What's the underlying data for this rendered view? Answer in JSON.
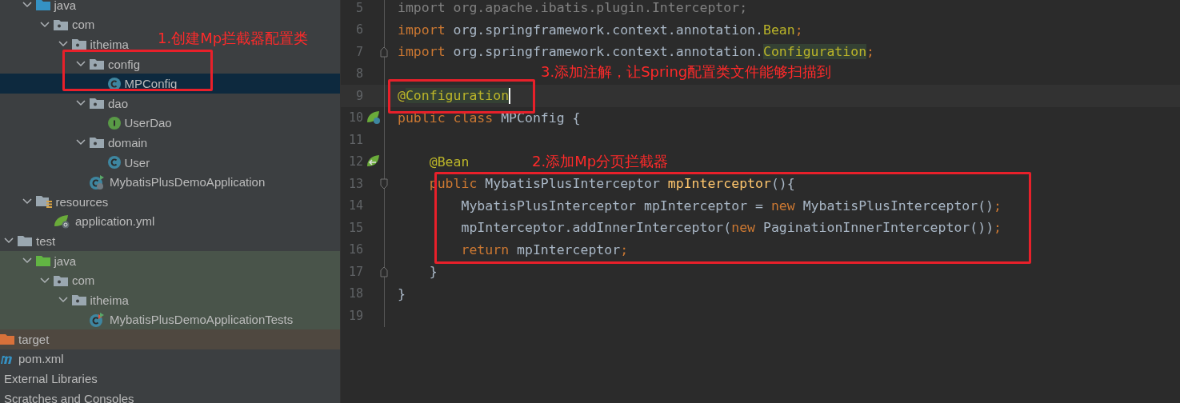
{
  "project_tree": [
    {
      "kind": "offscreen",
      "children": [
        {
          "label": "java",
          "kind": "source-folder",
          "expanded": true,
          "selected": false,
          "children": [
            {
              "label": "com",
              "kind": "package",
              "expanded": true,
              "selected": false,
              "children": [
                {
                  "label": "itheima",
                  "kind": "package",
                  "expanded": true,
                  "selected": false,
                  "children": [
                    {
                      "label": "config",
                      "kind": "package",
                      "expanded": true,
                      "selected": false,
                      "children": [
                        {
                          "label": "MPConfig",
                          "kind": "class",
                          "selected": true
                        }
                      ]
                    },
                    {
                      "label": "dao",
                      "kind": "package",
                      "expanded": true,
                      "selected": false,
                      "children": [
                        {
                          "label": "UserDao",
                          "kind": "interface",
                          "selected": false
                        }
                      ]
                    },
                    {
                      "label": "domain",
                      "kind": "package",
                      "expanded": true,
                      "selected": false,
                      "children": [
                        {
                          "label": "User",
                          "kind": "class",
                          "selected": false
                        }
                      ]
                    },
                    {
                      "label": "MybatisPlusDemoApplication",
                      "kind": "spring-app",
                      "selected": false
                    }
                  ]
                }
              ]
            }
          ]
        },
        {
          "label": "resources",
          "kind": "resources-folder",
          "expanded": true,
          "selected": false,
          "children": [
            {
              "label": "application.yml",
              "kind": "spring-yml",
              "selected": false
            }
          ]
        }
      ]
    },
    {
      "label": "test",
      "kind": "folder",
      "expanded": true,
      "selected": false,
      "children": [
        {
          "label": "java",
          "kind": "test-folder",
          "expanded": true,
          "selected": false,
          "color": "#49544a",
          "children": [
            {
              "label": "com",
              "kind": "package",
              "expanded": true,
              "selected": false,
              "color": "#49544a",
              "children": [
                {
                  "label": "itheima",
                  "kind": "package",
                  "expanded": true,
                  "selected": false,
                  "color": "#49544a",
                  "children": [
                    {
                      "label": "MybatisPlusDemoApplicationTests",
                      "kind": "test-class",
                      "selected": false,
                      "color": "#49544a"
                    }
                  ]
                }
              ]
            }
          ]
        }
      ]
    },
    {
      "label": "target",
      "kind": "excluded-folder",
      "selected": false,
      "color": "#4f4840"
    },
    {
      "label": "pom.xml",
      "kind": "maven",
      "selected": false
    },
    {
      "label": "External Libraries",
      "kind": "plain",
      "selected": false
    },
    {
      "label": "Scratches and Consoles",
      "kind": "plain",
      "selected": false
    }
  ],
  "editor": {
    "lines": [
      {
        "number": "5",
        "current": false,
        "tokens": [
          {
            "text": "import org.apache.ibatis.plugin.Interceptor;",
            "kind": "unused"
          }
        ]
      },
      {
        "number": "6",
        "current": false,
        "tokens": [
          {
            "text": "import ",
            "kind": "keyword"
          },
          {
            "text": "org.springframework.context.annotation.",
            "kind": "plain"
          },
          {
            "text": "Bean",
            "kind": "annotation"
          },
          {
            "text": ";",
            "kind": "keyword"
          }
        ]
      },
      {
        "number": "7",
        "current": false,
        "gutter": {
          "kind": "fold-end"
        },
        "tokens": [
          {
            "text": "import ",
            "kind": "keyword"
          },
          {
            "text": "org.springframework.context.annotation.",
            "kind": "plain"
          },
          {
            "text": "Configuration",
            "kind": "annotation-hl"
          },
          {
            "text": ";",
            "kind": "keyword"
          }
        ]
      },
      {
        "number": "8",
        "current": false
      },
      {
        "number": "9",
        "current": true,
        "tokens": [
          {
            "text": "@",
            "kind": "annotation"
          },
          {
            "text": "Configuration",
            "kind": "annotation-hl"
          }
        ]
      },
      {
        "number": "10",
        "current": false,
        "gutter": {
          "kind": "bean"
        },
        "tokens": [
          {
            "text": "public class ",
            "kind": "keyword"
          },
          {
            "text": "MPConfig {",
            "kind": "plain"
          }
        ]
      },
      {
        "number": "11",
        "current": false
      },
      {
        "number": "12",
        "current": false,
        "gutter": {
          "kind": "bean-link"
        },
        "tokens": [
          {
            "text": "    @Bean",
            "kind": "annotation"
          }
        ]
      },
      {
        "number": "13",
        "current": false,
        "gutter": {
          "kind": "fold-start"
        },
        "tokens": [
          {
            "text": "    public ",
            "kind": "keyword"
          },
          {
            "text": "MybatisPlusInterceptor ",
            "kind": "plain"
          },
          {
            "text": "mpInterceptor",
            "kind": "method"
          },
          {
            "text": "(){",
            "kind": "plain"
          }
        ]
      },
      {
        "number": "14",
        "current": false,
        "tokens": [
          {
            "text": "        MybatisPlusInterceptor mpInterceptor = ",
            "kind": "plain"
          },
          {
            "text": "new ",
            "kind": "keyword"
          },
          {
            "text": "MybatisPlusInterceptor()",
            "kind": "plain"
          },
          {
            "text": ";",
            "kind": "keyword"
          }
        ]
      },
      {
        "number": "15",
        "current": false,
        "tokens": [
          {
            "text": "        mpInterceptor.addInnerInterceptor(",
            "kind": "plain"
          },
          {
            "text": "new ",
            "kind": "keyword"
          },
          {
            "text": "PaginationInnerInterceptor())",
            "kind": "plain"
          },
          {
            "text": ";",
            "kind": "keyword"
          }
        ]
      },
      {
        "number": "16",
        "current": false,
        "tokens": [
          {
            "text": "        return ",
            "kind": "keyword"
          },
          {
            "text": "mpInterceptor",
            "kind": "plain"
          },
          {
            "text": ";",
            "kind": "keyword"
          }
        ]
      },
      {
        "number": "17",
        "current": false,
        "gutter": {
          "kind": "fold-end"
        },
        "tokens": [
          {
            "text": "    }",
            "kind": "plain"
          }
        ]
      },
      {
        "number": "18",
        "current": false,
        "tokens": [
          {
            "text": "}",
            "kind": "plain"
          }
        ]
      },
      {
        "number": "19",
        "current": false
      }
    ]
  },
  "annotations": [
    {
      "kind": "tree",
      "text": "1.创建Mp拦截器配置类"
    },
    {
      "kind": "config",
      "text": "3.添加注解，让Spring配置类文件能够扫描到"
    },
    {
      "kind": "bean",
      "text": "2.添加Mp分页拦截器"
    }
  ]
}
